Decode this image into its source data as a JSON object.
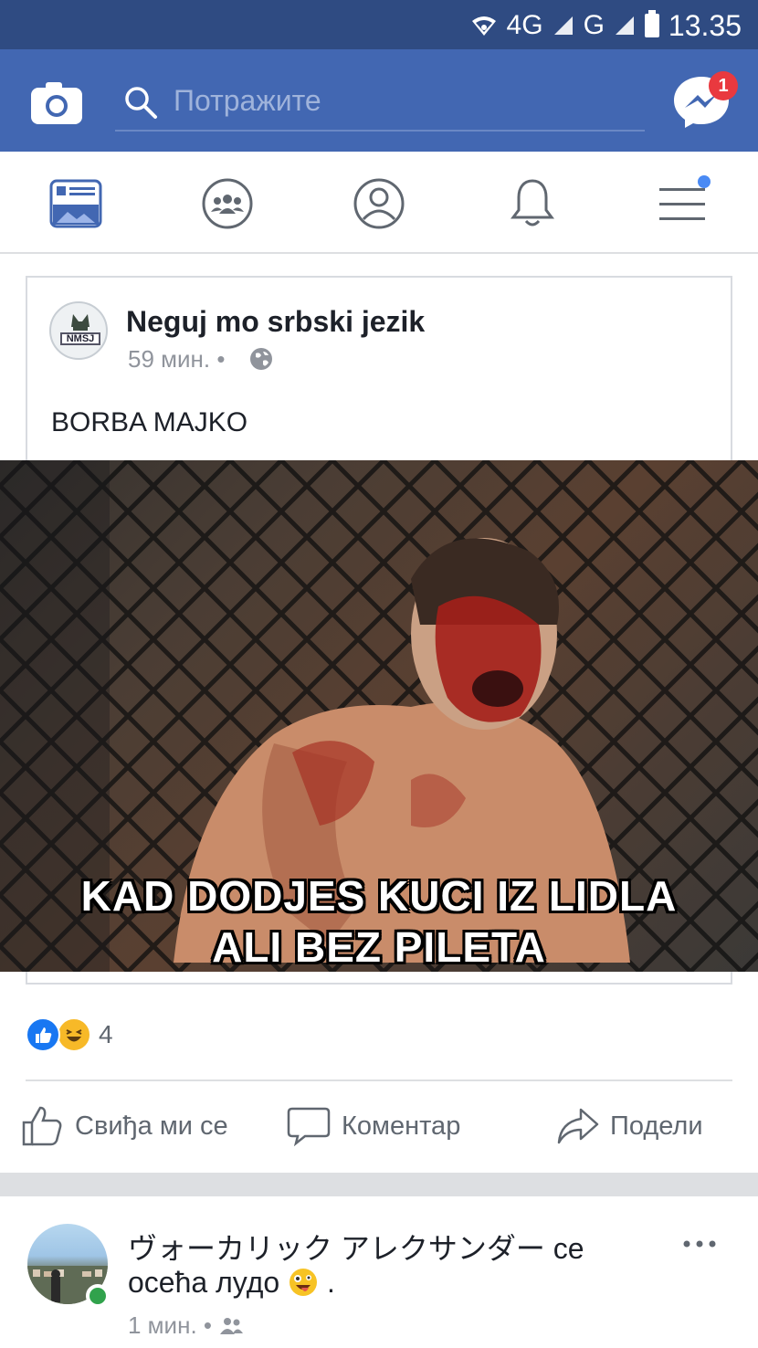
{
  "status_bar": {
    "network_1": "4G",
    "network_2": "G",
    "time": "13.35"
  },
  "top_bar": {
    "search_placeholder": "Потражите",
    "messenger_badge": "1",
    "camera_icon": "camera-icon",
    "search_icon": "search-icon",
    "messenger_icon": "messenger-icon"
  },
  "nav_tabs": [
    {
      "name": "news-feed",
      "icon": "news-feed-icon",
      "active": true
    },
    {
      "name": "groups",
      "icon": "groups-icon",
      "active": false
    },
    {
      "name": "profile",
      "icon": "profile-icon",
      "active": false
    },
    {
      "name": "notifications",
      "icon": "bell-icon",
      "active": false
    },
    {
      "name": "menu",
      "icon": "menu-icon",
      "active": false
    }
  ],
  "post": {
    "page_name": "Neguj mo srbski jezik",
    "avatar_text": "NMSJ",
    "time": "59 мин. •",
    "text": "BORBA MAJKO",
    "meme_caption_line1": "KAD DODJES KUCI IZ LIDLA",
    "meme_caption_line2": "ALI BEZ PILETA",
    "reaction_count": "4",
    "actions": {
      "like": "Свиђа ми се",
      "comment": "Коментар",
      "share": "Подели"
    }
  },
  "next_post": {
    "line1": "ヴォーカリック アレクサンダー се",
    "line2": "осећа лудо",
    "line2_end": ".",
    "time": "1 мин. •"
  },
  "colors": {
    "status_bar": "#2f4b82",
    "facebook_blue": "#4267b2",
    "active_tab": "#4267b2",
    "muted_text": "#90949c"
  }
}
